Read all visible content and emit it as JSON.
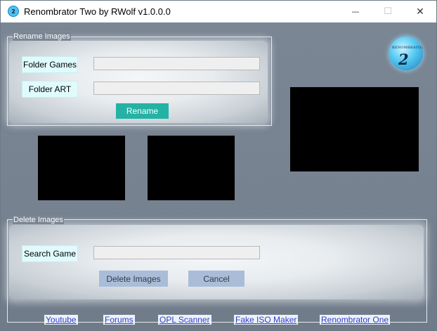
{
  "window": {
    "title": "Renombrator Two by RWolf v1.0.0.0",
    "controls": {
      "minimize": "—",
      "maximize": "☐",
      "close": "✕"
    }
  },
  "logo": {
    "text": "RENOMBRATOR",
    "number": "2"
  },
  "rename_group": {
    "label": "Rename Images",
    "folder_games_label": "Folder Games",
    "folder_games_value": "",
    "folder_art_label": "Folder ART",
    "folder_art_value": "",
    "rename_button": "Rename"
  },
  "delete_group": {
    "label": "Delete Images",
    "search_game_label": "Search Game",
    "search_game_value": "",
    "delete_button": "Delete Images",
    "cancel_button": "Cancel"
  },
  "links": {
    "youtube": "Youtube",
    "forums": "Forums",
    "opl_scanner": "OPL Scanner",
    "fake_iso_maker": "Fake ISO Maker",
    "renombrator_one": "Renombrator One"
  },
  "colors": {
    "background": "#74808f",
    "label_bg": "#dffbfd",
    "rename_button": "#24b2a4",
    "action_button": "#a9bdd9",
    "link_text": "#2b3fd0"
  }
}
